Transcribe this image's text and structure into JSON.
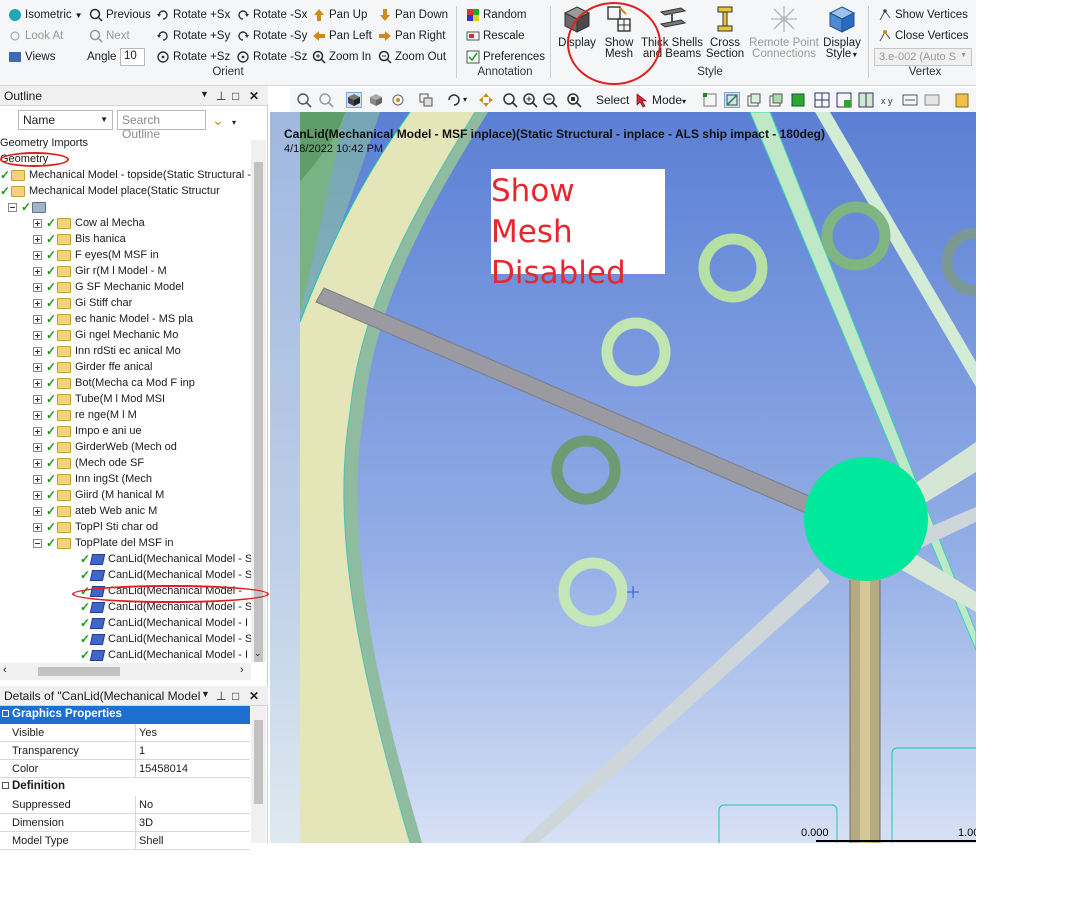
{
  "ribbon": {
    "view": {
      "isometric": "Isometric",
      "previous": "Previous",
      "look_at": "Look At",
      "next": "Next",
      "views": "Views",
      "angle_label": "Angle",
      "angle_value": "10",
      "rotate_px": "Rotate +Sx",
      "rotate_mx": "Rotate -Sx",
      "rotate_py": "Rotate +Sy",
      "rotate_my": "Rotate -Sy",
      "rotate_pz": "Rotate +Sz",
      "rotate_mz": "Rotate -Sz",
      "pan_up": "Pan Up",
      "pan_down": "Pan Down",
      "pan_left": "Pan Left",
      "pan_right": "Pan Right",
      "zoom_in": "Zoom In",
      "zoom_out": "Zoom Out",
      "group_label": "Orient"
    },
    "annotation": {
      "random": "Random",
      "rescale": "Rescale",
      "preferences": "Preferences",
      "group_label": "Annotation"
    },
    "style": {
      "display": "Display",
      "show_mesh_1": "Show",
      "show_mesh_2": "Mesh",
      "thick_1": "Thick Shells",
      "thick_2": "and Beams",
      "cross_1": "Cross",
      "cross_2": "Section",
      "remote_1": "Remote Point",
      "remote_2": "Connections",
      "display_style_1": "Display",
      "display_style_2": "Style",
      "group_label": "Style"
    },
    "vertex": {
      "show_vertices": "Show Vertices",
      "close_vertices": "Close Vertices",
      "tolerance": "3.e-002 (Auto S",
      "group_label": "Vertex"
    }
  },
  "outline": {
    "title": "Outline",
    "name_filter": "Name",
    "search_placeholder": "Search Outline",
    "tree": [
      {
        "label": "Geometry Imports"
      },
      {
        "label": "Geometry"
      },
      {
        "label": "Mechanical Model - topside(Static Structural - in"
      },
      {
        "label": "Mechanical Model     place(Static Structur"
      },
      {
        "label": "    "
      },
      {
        "label": "Cow            al Mecha     "
      },
      {
        "label": "Bis             hanica       "
      },
      {
        "label": "F   eyes(M               MSF in"
      },
      {
        "label": "Gir     r(M       l Model - M"
      },
      {
        "label": "G      SF       Mechanic   Model"
      },
      {
        "label": "Gi   Stiff    char     "
      },
      {
        "label": "     ec  hanic   Model - MS  pla"
      },
      {
        "label": "Gi   ngel     Mechanic  Mo"
      },
      {
        "label": "Inn   rdSti     ec  anical Mo"
      },
      {
        "label": "Girder     ffe   anical  "
      },
      {
        "label": "    Bot(Mecha  ca    Mod   F inp"
      },
      {
        "label": "   Tube(M      l Mod    MSI"
      },
      {
        "label": "   re   nge(M       l M    "
      },
      {
        "label": "Impo     e   ani    ue  "
      },
      {
        "label": "GirderWeb     (Mech      od"
      },
      {
        "label": "      (Mech      ode    SF  "
      },
      {
        "label": "Inn    ingSt     (Mech"
      },
      {
        "label": "Giird   (M       hanical M  "
      },
      {
        "label": "    ateb  Web     anic   M  "
      },
      {
        "label": "TopPl   Sti     char    od"
      },
      {
        "label": "TopPlate           del   MSF in"
      },
      {
        "label": "CanLid(Mechanical Model - S"
      },
      {
        "label": "CanLid(Mechanical Model - S"
      },
      {
        "label": "CanLid(Mechanical Model -"
      },
      {
        "label": "CanLid(Mechanical Model - S"
      },
      {
        "label": "CanLid(Mechanical Model - I"
      },
      {
        "label": "CanLid(Mechanical Model - S"
      },
      {
        "label": "CanLid(Mechanical Model - I"
      }
    ]
  },
  "details": {
    "title": "Details of \"CanLid(Mechanical Model",
    "sections": [
      {
        "name": "Graphics Properties",
        "rows": [
          {
            "k": "Visible",
            "v": "Yes"
          },
          {
            "k": "Transparency",
            "v": "1"
          },
          {
            "k": "Color",
            "v": "15458014"
          }
        ]
      },
      {
        "name": "Definition",
        "rows": [
          {
            "k": "Suppressed",
            "v": "No"
          },
          {
            "k": "Dimension",
            "v": "3D"
          },
          {
            "k": "Model Type",
            "v": "Shell"
          }
        ]
      }
    ]
  },
  "viewport_toolbar": {
    "select": "Select",
    "mode": "Mode"
  },
  "viewport": {
    "title": "CanLid(Mechanical Model - MSF inplace)(Static Structural - inplace - ALS ship impact - 180deg)",
    "date": "4/18/2022 10:42 PM",
    "annotation_line1": "Show Mesh",
    "annotation_line2": "Disabled",
    "scale_start": "0.000",
    "scale_end": "1.00",
    "colors": {
      "sky_top": "#5b7fd4",
      "sky_bottom": "#c8d6f2",
      "annotation": "#e8262e",
      "body_highlight": "#00e89c"
    }
  }
}
